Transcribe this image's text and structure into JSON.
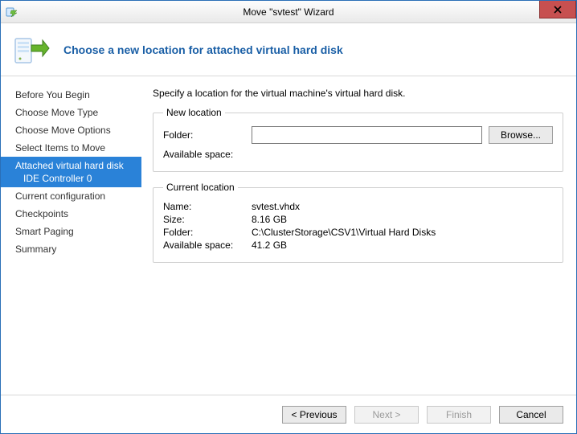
{
  "window": {
    "title": "Move \"svtest\" Wizard"
  },
  "header": {
    "heading": "Choose a new location for attached virtual hard disk"
  },
  "sidebar": {
    "items": [
      {
        "label": "Before You Begin",
        "selected": false
      },
      {
        "label": "Choose Move Type",
        "selected": false
      },
      {
        "label": "Choose Move Options",
        "selected": false
      },
      {
        "label": "Select Items to Move",
        "selected": false
      },
      {
        "label": "Attached virtual hard disk",
        "sub": "IDE Controller 0",
        "selected": true
      },
      {
        "label": "Current configuration",
        "selected": false
      },
      {
        "label": "Checkpoints",
        "selected": false
      },
      {
        "label": "Smart Paging",
        "selected": false
      },
      {
        "label": "Summary",
        "selected": false
      }
    ]
  },
  "main": {
    "instruction": "Specify a location for the virtual machine's virtual hard disk.",
    "new_location": {
      "legend": "New location",
      "folder_label": "Folder:",
      "folder_value": "",
      "browse_label": "Browse...",
      "avail_label": "Available space:",
      "avail_value": ""
    },
    "current_location": {
      "legend": "Current location",
      "name_label": "Name:",
      "name_value": "svtest.vhdx",
      "size_label": "Size:",
      "size_value": "8.16 GB",
      "folder_label": "Folder:",
      "folder_value": "C:\\ClusterStorage\\CSV1\\Virtual Hard Disks",
      "avail_label": "Available space:",
      "avail_value": "41.2 GB"
    }
  },
  "footer": {
    "previous": "< Previous",
    "next": "Next >",
    "finish": "Finish",
    "cancel": "Cancel"
  }
}
